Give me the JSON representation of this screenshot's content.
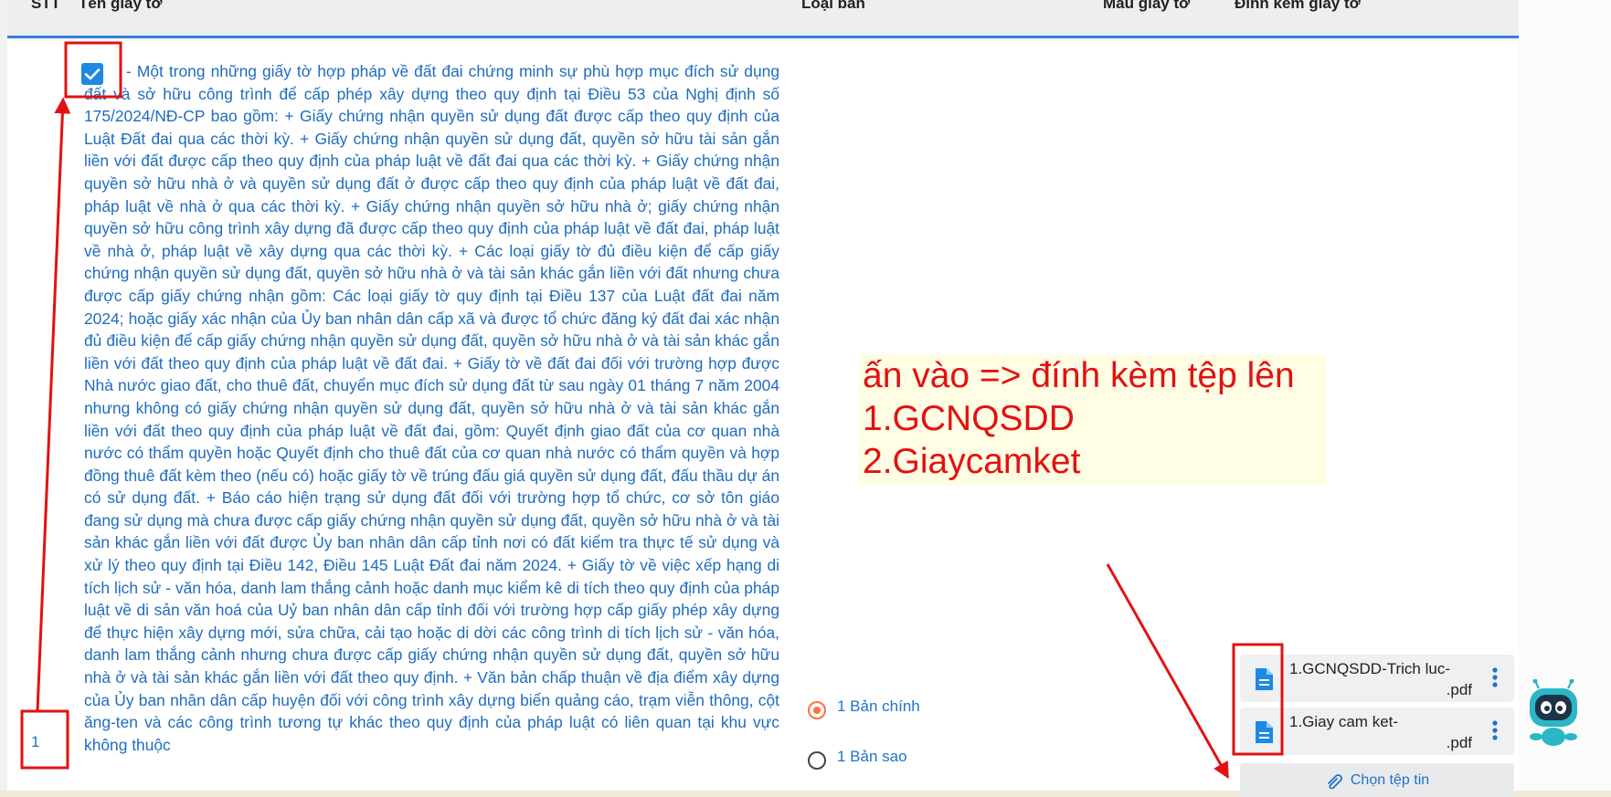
{
  "table_header": {
    "stt": "STT",
    "name": "Tên giấy tờ",
    "type": "Loại bản",
    "template": "Mẫu giấy tờ",
    "attach": "Đính kèm giấy tờ"
  },
  "row": {
    "index": "1",
    "checked": true,
    "description": "- Một trong những giấy tờ hợp pháp về đất đai chứng minh sự phù hợp mục đích sử dụng đất và sở hữu công trình để cấp phép xây dựng theo quy định tại Điều 53 của Nghị định số 175/2024/NĐ-CP bao gồm: + Giấy chứng nhận quyền sử dụng đất được cấp theo quy định của Luật Đất đai qua các thời kỳ. + Giấy chứng nhận quyền sử dụng đất, quyền sở hữu tài sản gắn liền với đất được cấp theo quy định của pháp luật về đất đai qua các thời kỳ. + Giấy chứng nhận quyền sở hữu nhà ở và quyền sử dụng đất ở được cấp theo quy định của pháp luật về đất đai, pháp luật về nhà ở qua các thời kỳ. + Giấy chứng nhận quyền sở hữu nhà ở; giấy chứng nhận quyền sở hữu công trình xây dựng đã được cấp theo quy định của pháp luật về đất đai, pháp luật về nhà ở, pháp luật về xây dựng qua các thời kỳ. + Các loại giấy tờ đủ điều kiện để cấp giấy chứng nhận quyền sử dụng đất, quyền sở hữu nhà ở và tài sản khác gắn liền với đất nhưng chưa được cấp giấy chứng nhận gồm: Các loại giấy tờ quy định tại Điều 137 của Luật đất đai năm 2024; hoặc giấy xác nhận của Ủy ban nhân dân cấp xã và được tổ chức đăng ký đất đai xác nhận đủ điều kiện để cấp giấy chứng nhận quyền sử dụng đất, quyền sở hữu nhà ở và tài sản khác gắn liền với đất theo quy định của pháp luật về đất đai. + Giấy tờ về đất đai đối với trường hợp được Nhà nước giao đất, cho thuê đất, chuyển mục đích sử dụng đất từ sau ngày 01 tháng 7 năm 2004 nhưng không có giấy chứng nhận quyền sử dụng đất, quyền sở hữu nhà ở và tài sản khác gắn liền với đất theo quy định của pháp luật về đất đai, gồm: Quyết định giao đất của cơ quan nhà nước có thẩm quyền hoặc Quyết định cho thuê đất của cơ quan nhà nước có thẩm quyền và hợp đồng thuê đất kèm theo (nếu có) hoặc giấy tờ về trúng đấu giá quyền sử dụng đất, đấu thầu dự án có sử dụng đất. + Báo cáo hiện trạng sử dụng đất đối với trường hợp tổ chức, cơ sở tôn giáo đang sử dụng mà chưa được cấp giấy chứng nhận quyền sử dụng đất, quyền sở hữu nhà ở và tài sản khác gắn liền với đất được Ủy ban nhân dân cấp tỉnh nơi có đất kiểm tra thực tế sử dụng và xử lý theo quy định tại Điều 142, Điều 145 Luật Đất đai năm 2024. + Giấy tờ về việc xếp hạng di tích lịch sử - văn hóa, danh lam thắng cảnh hoặc danh mục kiểm kê di tích theo quy định của pháp luật về di sản văn hoá của Uỷ ban nhân dân cấp tỉnh đối với trường hợp cấp giấy phép xây dựng để thực hiện xây dựng mới, sửa chữa, cải tạo hoặc di dời các công trình di tích lịch sử - văn hóa, danh lam thắng cảnh nhưng chưa được cấp giấy chứng nhận quyền sử dụng đất, quyền sở hữu nhà ở và tài sản khác gắn liền với đất theo quy định. + Văn bản chấp thuận về địa điểm xây dựng của Ủy ban nhân dân cấp huyện đối với công trình xây dựng biển quảng cáo, trạm viễn thông, cột ăng-ten và các công trình tương tự khác theo quy định của pháp luật có liên quan tại khu vực không thuộc",
    "copy_options": [
      {
        "label": "1 Bản chính",
        "selected": true
      },
      {
        "label": "1 Bản sao",
        "selected": false
      }
    ],
    "files": [
      {
        "name_line1": "1.GCNQSDD-Trich luc-",
        "name_line2": ".pdf"
      },
      {
        "name_line1": "1.Giay cam ket-",
        "name_line2": ".pdf"
      }
    ],
    "choose_file_label": "Chọn tệp tin"
  },
  "annotation": {
    "lines": [
      "ấn vào => đính kèm tệp lên",
      "1.GCNQSDD",
      "2.Giaycamket"
    ],
    "color": "#e11212"
  },
  "colors": {
    "primary_blue": "#1e73c9",
    "header_bg": "#eeeeee",
    "header_underline": "#2f80d8",
    "radio_selected": "#ff7043",
    "annotation_bg": "#fffde4"
  },
  "icons": [
    "checkbox-checked-icon",
    "file-icon",
    "more-vert-icon",
    "paperclip-icon",
    "chatbot-mascot-icon"
  ]
}
